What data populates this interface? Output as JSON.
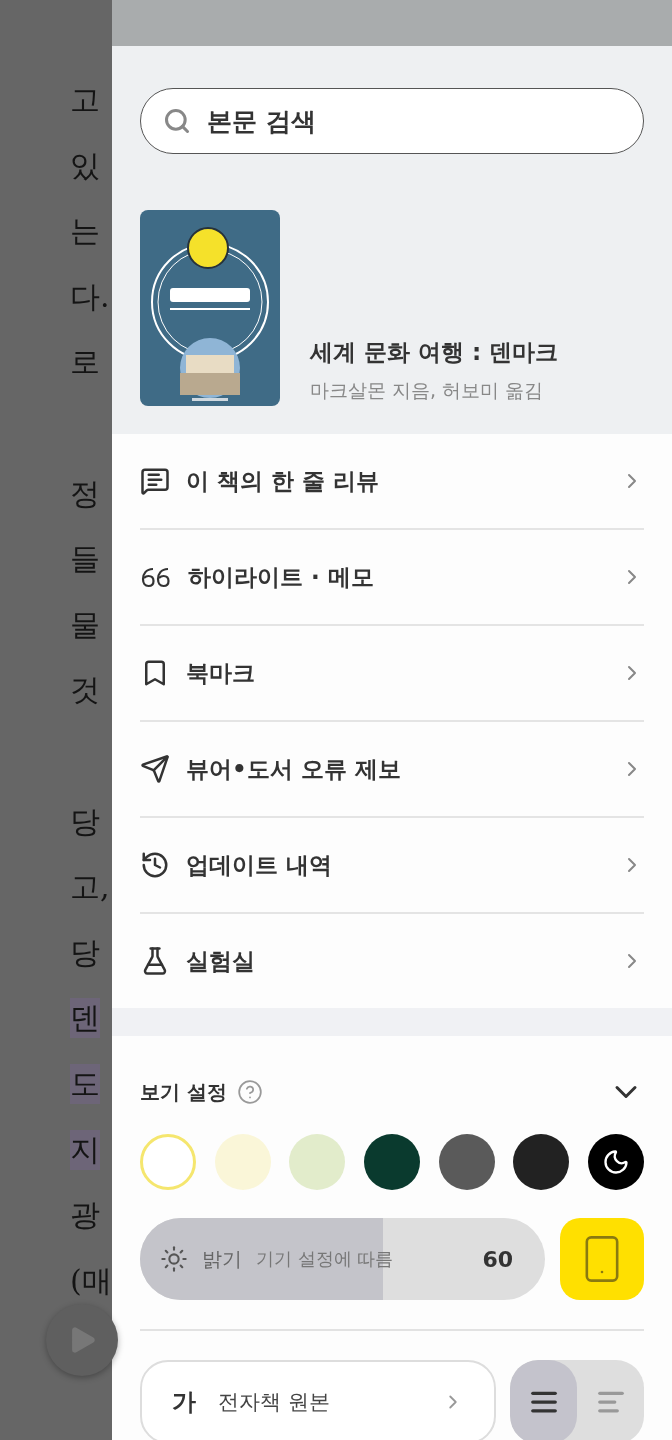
{
  "reader": {
    "paragraphs": [
      {
        "lines": [
          {
            "text": "고",
            "highlighted": false
          },
          {
            "text": "있",
            "highlighted": false
          },
          {
            "text": "는",
            "highlighted": false
          },
          {
            "text": "다.",
            "highlighted": false
          },
          {
            "text": "로",
            "highlighted": false
          }
        ]
      },
      {
        "lines": [
          {
            "text": "정",
            "highlighted": false
          },
          {
            "text": "들",
            "highlighted": false
          },
          {
            "text": "물",
            "highlighted": false
          },
          {
            "text": "것",
            "highlighted": false
          }
        ]
      },
      {
        "lines": [
          {
            "text": "당",
            "highlighted": false
          },
          {
            "text": "고,",
            "highlighted": false
          },
          {
            "text": "당",
            "highlighted": false
          },
          {
            "text": "덴",
            "highlighted": true
          },
          {
            "text": "도",
            "highlighted": true
          },
          {
            "text": "지",
            "highlighted": true
          },
          {
            "text": "광",
            "highlighted": false
          },
          {
            "text": "(매",
            "highlighted": false
          }
        ]
      }
    ]
  },
  "search": {
    "placeholder": "본문 검색"
  },
  "book": {
    "title": "세계 문화 여행 : 덴마크",
    "authors": "마크살몬 지음, 허보미 옮김"
  },
  "menu": [
    {
      "label": "이 책의 한 줄 리뷰"
    },
    {
      "label": "하이라이트 · 메모"
    },
    {
      "label": "북마크"
    },
    {
      "label": "뷰어•도서 오류 제보"
    },
    {
      "label": "업데이트 내역"
    },
    {
      "label": "실험실"
    }
  ],
  "view_settings": {
    "title": "보기 설정",
    "expanded": true,
    "themes": [
      {
        "kind": "color",
        "color": "#ffffff",
        "selected": true
      },
      {
        "kind": "color",
        "color": "#faf6d8",
        "selected": false
      },
      {
        "kind": "color",
        "color": "#e2eccb",
        "selected": false
      },
      {
        "kind": "color",
        "color": "#0a3a2e",
        "selected": false
      },
      {
        "kind": "color",
        "color": "#5a5a5a",
        "selected": false
      },
      {
        "kind": "color",
        "color": "#222222",
        "selected": false
      },
      {
        "kind": "night",
        "color": "#000000",
        "selected": false
      }
    ],
    "brightness": {
      "label": "밝기",
      "hint": "기기 설정에 따름",
      "level": 0.6,
      "reading": "60",
      "auto": true
    },
    "font": {
      "glyph": "가",
      "label": "전자책 원본"
    },
    "alignment": [
      {
        "kind": "justify",
        "selected": true
      },
      {
        "kind": "left",
        "selected": false
      }
    ]
  }
}
